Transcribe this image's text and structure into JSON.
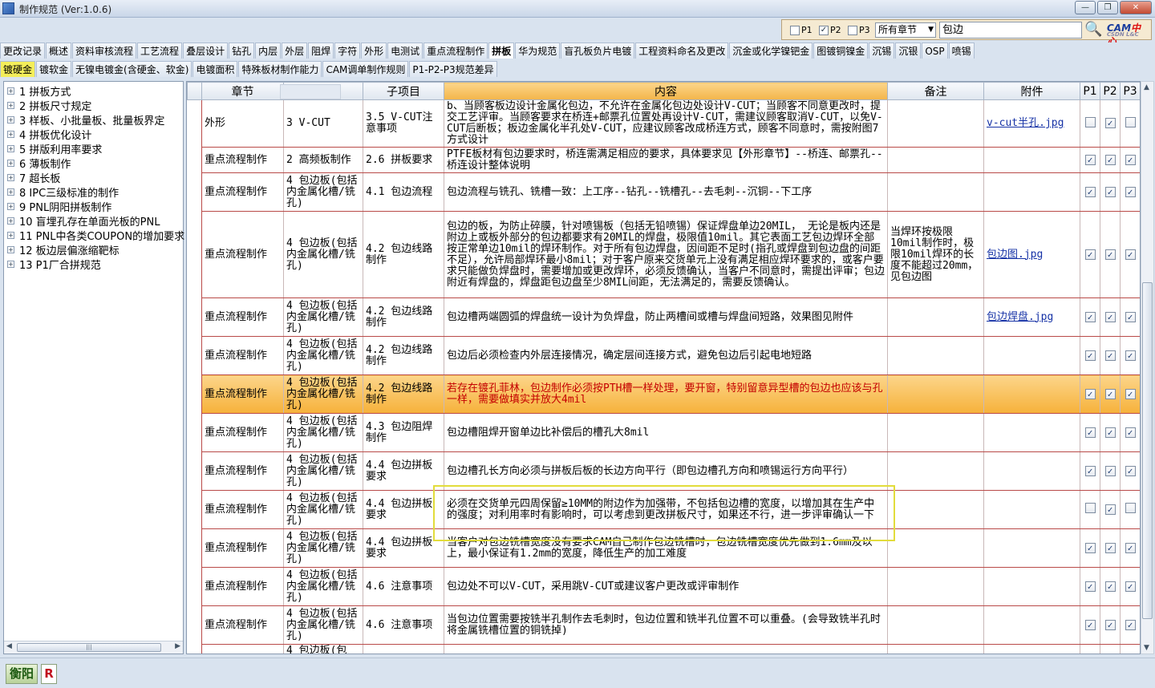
{
  "window": {
    "title": "制作规范 (Ver:1.0.6)"
  },
  "filter": {
    "p1_label": "P1",
    "p1_checked": false,
    "p2_label": "P2",
    "p2_checked": true,
    "p3_label": "P3",
    "p3_checked": false,
    "chapter_select": "所有章节",
    "search_value": "包边",
    "logo_text": "CAM",
    "logo_text_red": "中心",
    "logo_sub": "CSDN L&C"
  },
  "tabs_row1": [
    "更改记录",
    "概述",
    "资料审核流程",
    "工艺流程",
    "叠层设计",
    "钻孔",
    "内层",
    "外层",
    "阻焊",
    "字符",
    "外形",
    "电测试",
    "重点流程制作",
    "拼板",
    "华为规范",
    "盲孔板负片电镀",
    "工程资料命名及更改",
    "沉金或化学镍钯金",
    "图镀铜镍金",
    "沉锡",
    "沉银",
    "OSP",
    "喷锡"
  ],
  "tabs_row1_selected": "拼板",
  "tabs_row2": [
    "镀硬金",
    "镀软金",
    "无镍电镀金(含硬金、软金)",
    "电镀面积",
    "特殊板材制作能力",
    "CAM调单制作规则",
    "P1-P2-P3规范差异"
  ],
  "tabs_row2_selected": "镀硬金",
  "tree": [
    "1  拼板方式",
    "2  拼板尺寸规定",
    "3  样板、小批量板、批量板界定",
    "4  拼板优化设计",
    "5  拼版利用率要求",
    "6  薄板制作",
    "7  超长板",
    "8  IPC三级标准的制作",
    "9  PNL阴阳拼板制作",
    "10  盲埋孔存在单面光板的PNL",
    "11  PNL中各类COUPON的增加要求",
    "12  板边层偏涨缩靶标",
    "13  P1厂合拼规范"
  ],
  "grid": {
    "headers": [
      "章节",
      "项目",
      "子项目",
      "内容",
      "备注",
      "附件",
      "P1",
      "P2",
      "P3"
    ],
    "rows": [
      {
        "chapter": "外形",
        "item": "3 V-CUT",
        "sub": "3.5 V-CUT注意事项",
        "content": "b、当顾客板边设计金属化包边，不允许在金属化包边处设计V-CUT；当顾客不同意更改时，提交工艺评审。当顾客要求在桥连+邮票孔位置处再设计V-CUT，需建议顾客取消V-CUT，以免V-CUT后断板；板边金属化半孔处V-CUT，应建议顾客改成桥连方式，顾客不同意时，需按附图7方式设计",
        "note": "",
        "attach": "v-cut半孔.jpg",
        "p1": false,
        "p2": true,
        "p3": false,
        "h": 55
      },
      {
        "chapter": "重点流程制作",
        "item": "2 高频板制作",
        "sub": "2.6 拼板要求",
        "content": "PTFE板材有包边要求时，桥连需满足相应的要求，具体要求见【外形章节】--桥连、邮票孔--桥连设计整体说明",
        "note": "",
        "attach": "",
        "p1": true,
        "p2": true,
        "p3": true,
        "h": 32
      },
      {
        "chapter": "重点流程制作",
        "item": "4 包边板(包括内金属化槽/铣孔)",
        "sub": "4.1 包边流程",
        "content": "包边流程与铣孔、铣槽一致：上工序--钻孔--铣槽孔--去毛刺--沉铜--下工序",
        "note": "",
        "attach": "",
        "p1": true,
        "p2": true,
        "p3": true,
        "h": 48
      },
      {
        "chapter": "重点流程制作",
        "item": "4 包边板(包括内金属化槽/铣孔)",
        "sub": "4.2 包边线路制作",
        "content": "包边的板，为防止碎膜，针对喷锡板（包括无铅喷锡）保证焊盘单边20MIL， 无论是板内还是附边上或板外部分的包边都要求有20MIL的焊盘，极限值10mil。其它表面工艺包边焊环全部按正常单边10mil的焊环制作。对于所有包边焊盘，因间距不足时(指孔或焊盘到包边盘的间距不足），允许局部焊环最小8mil；对于客户原来交货单元上没有满足相应焊环要求的，或客户要求只能做负焊盘时，需要增加或更改焊环，必须反馈确认，当客户不同意时，需提出评审；包边附近有焊盘的，焊盘距包边盘至少8MIL间距，无法满足的，需要反馈确认。",
        "note": "当焊环按极限10mil制作时，极限10mil焊环的长度不能超过20mm，见包边图",
        "attach": "包边图.jpg",
        "p1": true,
        "p2": true,
        "p3": true,
        "h": 108
      },
      {
        "chapter": "重点流程制作",
        "item": "4 包边板(包括内金属化槽/铣孔)",
        "sub": "4.2 包边线路制作",
        "content": "包边槽两端圆弧的焊盘统一设计为负焊盘，防止两槽间或槽与焊盘间短路，效果图见附件",
        "note": "",
        "attach": "包边焊盘.jpg",
        "p1": true,
        "p2": true,
        "p3": true,
        "h": 48
      },
      {
        "chapter": "重点流程制作",
        "item": "4 包边板(包括内金属化槽/铣孔)",
        "sub": "4.2 包边线路制作",
        "content": "包边后必须检查内外层连接情况，确定层间连接方式，避免包边后引起电地短路",
        "note": "",
        "attach": "",
        "p1": true,
        "p2": true,
        "p3": true,
        "h": 48
      },
      {
        "chapter": "重点流程制作",
        "item": "4 包边板(包括内金属化槽/铣孔)",
        "sub": "4.2 包边线路制作",
        "content": "若存在镀孔菲林，包边制作必须按PTH槽一样处理，要开窗，特别留意异型槽的包边也应该与孔一样，需要做填实并放大4mil",
        "note": "",
        "attach": "",
        "p1": true,
        "p2": true,
        "p3": true,
        "h": 48,
        "highlight": true
      },
      {
        "chapter": "重点流程制作",
        "item": "4 包边板(包括内金属化槽/铣孔)",
        "sub": "4.3 包边阻焊制作",
        "content": "包边槽阻焊开窗单边比补偿后的槽孔大8mil",
        "note": "",
        "attach": "",
        "p1": true,
        "p2": true,
        "p3": true,
        "h": 48
      },
      {
        "chapter": "重点流程制作",
        "item": "4 包边板(包括内金属化槽/铣孔)",
        "sub": "4.4 包边拼板要求",
        "content": "包边槽孔长方向必须与拼板后板的长边方向平行（即包边槽孔方向和喷锡运行方向平行）",
        "note": "",
        "attach": "",
        "p1": true,
        "p2": true,
        "p3": true,
        "h": 48
      },
      {
        "chapter": "重点流程制作",
        "item": "4 包边板(包括内金属化槽/铣孔)",
        "sub": "4.4 包边拼板要求",
        "content": "必须在交货单元四周保留≥10MM的附边作为加强带，不包括包边槽的宽度，以增加其在生产中的强度；对利用率时有影响时，可以考虑到更改拼板尺寸，如果还不行，进一步评审确认一下",
        "note": "",
        "attach": "",
        "p1": false,
        "p2": true,
        "p3": false,
        "h": 48
      },
      {
        "chapter": "重点流程制作",
        "item": "4 包边板(包括内金属化槽/铣孔)",
        "sub": "4.4 包边拼板要求",
        "content": "当客户对包边铣槽宽度没有要求CAM自己制作包边铣槽时，包边铣槽宽度优先做到1.6mm及以上，最小保证有1.2mm的宽度，降低生产的加工难度",
        "note": "",
        "attach": "",
        "p1": true,
        "p2": true,
        "p3": true,
        "h": 48
      },
      {
        "chapter": "重点流程制作",
        "item": "4 包边板(包括内金属化槽/铣孔)",
        "sub": "4.6 注意事项",
        "content": "包边处不可以V-CUT，采用跳V-CUT或建议客户更改或评审制作",
        "note": "",
        "attach": "",
        "p1": true,
        "p2": true,
        "p3": true,
        "h": 48
      },
      {
        "chapter": "重点流程制作",
        "item": "4 包边板(包括内金属化槽/铣孔)",
        "sub": "4.6 注意事项",
        "content": "当包边位置需要按铣半孔制作去毛刺时，包边位置和铣半孔位置不可以重叠。(会导致铣半孔时将金属铣槽位置的铜铣掉)",
        "note": "",
        "attach": "",
        "p1": true,
        "p2": true,
        "p3": true,
        "h": 48
      },
      {
        "chapter": "",
        "item": "4 包边板(包",
        "sub": "",
        "content": "",
        "note": "",
        "attach": "",
        "p1": false,
        "p2": false,
        "p3": false,
        "h": 14
      }
    ]
  },
  "status": {
    "btn1": "衡阳",
    "btn2": "R"
  }
}
